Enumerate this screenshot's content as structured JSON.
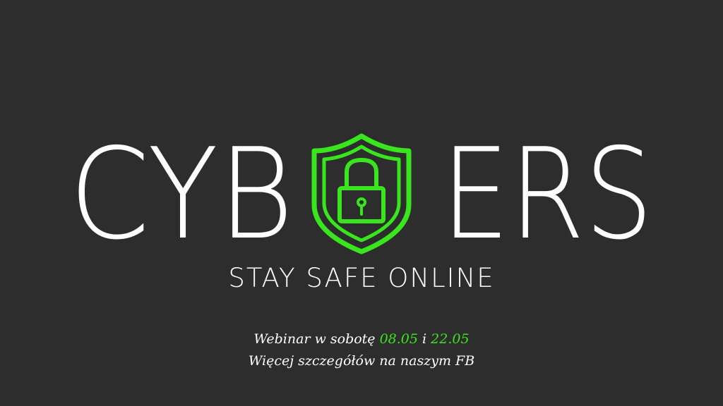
{
  "logo": {
    "word_left": "CYB",
    "word_right": "ERS",
    "icon": "shield-padlock-icon"
  },
  "tagline": "STAY SAFE ONLINE",
  "info": {
    "line1_prefix": "Webinar w sobotę ",
    "date1": "08.05",
    "conjunction": " i ",
    "date2": "22.05",
    "line2": "Więcej szczegółów na naszym FB"
  },
  "colors": {
    "background": "#2d2d2d",
    "text": "#ffffff",
    "accent": "#39e51d"
  }
}
